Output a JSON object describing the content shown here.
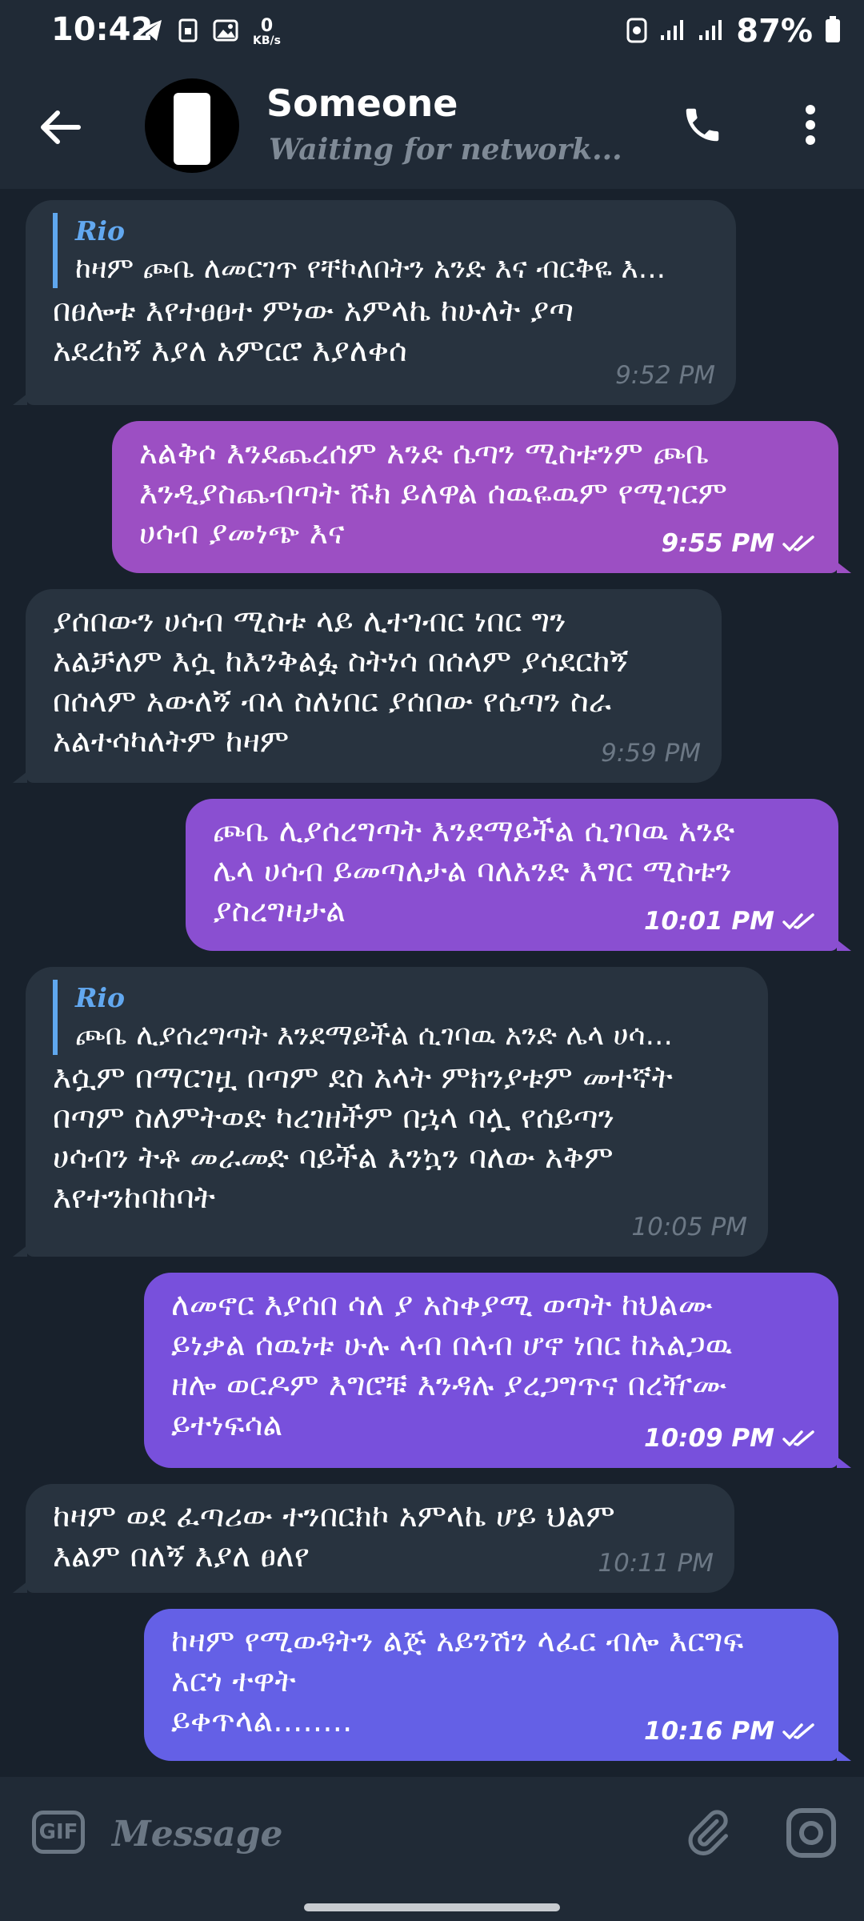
{
  "status_bar": {
    "time": "10:42",
    "net_speed_value": "0",
    "net_speed_unit": "KB/s",
    "battery": "87%",
    "icons": [
      "telegram-icon",
      "sim-icon",
      "gallery-icon",
      "data-saver-icon",
      "signal-icon",
      "signal-icon",
      "battery-icon"
    ]
  },
  "header": {
    "name": "Someone",
    "status": "Waiting for network...",
    "icons": [
      "back-arrow-icon",
      "phone-icon",
      "more-vert-icon"
    ]
  },
  "messages": [
    {
      "dir": "in",
      "reply_author": "Rio",
      "reply_text": "ከዛም ጮቤ ለመርገጥ የቸኮለበትን አንድ እና ብርቅዬ እ...",
      "text": "በፀሎቱ እየተፀፀተ ምነው አምላኬ ከሁለት ያጣ\nአደረከኝ እያለ አምርሮ እያለቀሰ",
      "time": "9:52 PM"
    },
    {
      "dir": "out",
      "text": "አልቅሶ እንደጨረሰም አንድ ሴጣን ሚስቱንም ጮቤ\nእንዲያስጨብጣት ሹክ ይለዋል ሰዉዬዉም የሚገርም\nሀሳብ ያመነጭ እና",
      "time": "9:55 PM",
      "color": "#9c4fc3"
    },
    {
      "dir": "in",
      "text": "ያሰበውን ሀሳብ ሚስቱ ላይ ሊተገብር ነበር ግን\nአልቻለም እሷ ከእንቅልፏ ስትነሳ በሰላም ያሳደርከኝ\nበሰላም አውለኝ ብላ ስለነበር ያሰበው የሴጣን ስራ\nአልተሳካለትም ከዛም",
      "time": "9:59 PM"
    },
    {
      "dir": "out",
      "text": "ጮቤ ሊያሰረግጣት እንደማይችል ሲገባዉ አንድ\nሌላ ሀሳብ ይመጣለታል ባለአንድ እግር ሚስቱን\nያስረግዛታል",
      "time": "10:01 PM",
      "color": "#8a4fd1"
    },
    {
      "dir": "in",
      "reply_author": "Rio",
      "reply_text": "ጮቤ ሊያሰረግጣት እንደማይችል ሲገባዉ አንድ ሌላ ሀሳ...",
      "text": "እሷም በማርገዟ በጣም ደስ አላት ምክንያቱም መተኛት\nበጣም ስለምትወድ  ካረገዘችም በኋላ ባሏ የሰይጣን\nሀሳብን ትቶ መራመድ ባይችል እንኳን ባለው አቅም\nእየተንከባከባት",
      "time": "10:05 PM"
    },
    {
      "dir": "out",
      "text": "ለመኖር እያሰበ ሳለ ያ አስቀያሚ ወጣት ከህልሙ\nይነቃል ሰዉነቱ ሁሉ ላብ በላብ ሆኖ ነበር ከአልጋዉ\nዘሎ ወርዶም እግሮቹ እንዳሉ ያረጋግጥና በረዥሙ\nይተነፍሳል",
      "time": "10:09 PM",
      "color": "#7850dc"
    },
    {
      "dir": "in",
      "text": "ከዛም ወደ ፈጣሪው ተንበርክኮ አምላኬ ሆይ ህልም\nእልም በለኝ እያለ ፀለየ",
      "time": "10:11 PM"
    },
    {
      "dir": "out",
      "text": "ከዛም የሚወዳትን ልጅ አይንሽን ላፈር ብሎ እርግፍ\nአርጎ ተዋት\nይቀጥላል........",
      "time": "10:16 PM",
      "color": "#6460e6"
    }
  ],
  "composer": {
    "gif_label": "GIF",
    "placeholder": "Message",
    "icons": [
      "gif-icon",
      "attach-icon",
      "camera-icon"
    ]
  }
}
